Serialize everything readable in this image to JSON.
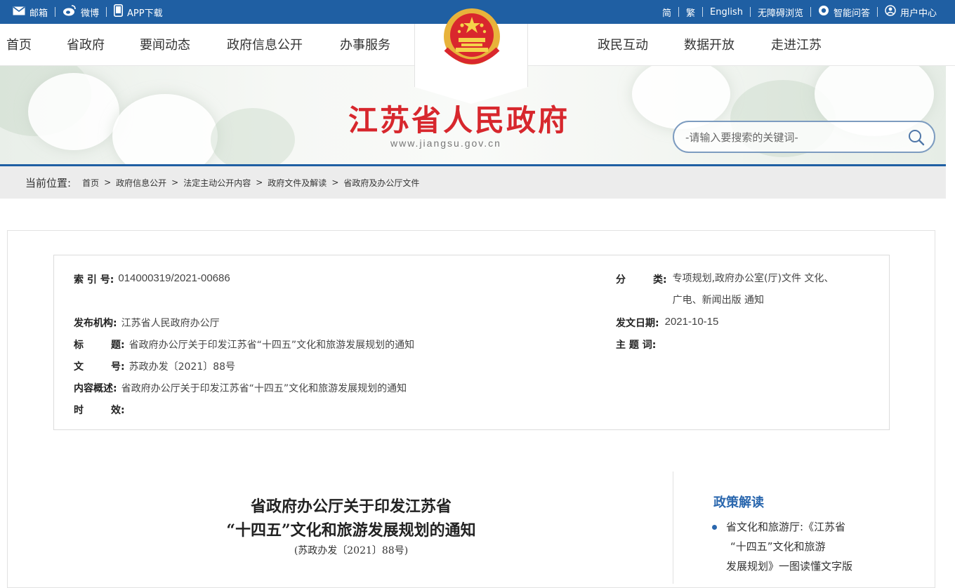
{
  "topbar": {
    "left": [
      {
        "icon": "mail-icon",
        "label": "邮箱"
      },
      {
        "icon": "weibo-icon",
        "label": "微博"
      },
      {
        "icon": "phone-icon",
        "label": "APP下载"
      }
    ],
    "right": [
      {
        "label": "简"
      },
      {
        "label": "繁"
      },
      {
        "label": "English"
      },
      {
        "label": "无障碍浏览"
      },
      {
        "icon": "service-icon",
        "label": "智能问答"
      },
      {
        "icon": "user-icon",
        "label": "用户中心"
      }
    ]
  },
  "nav": {
    "items": [
      "首页",
      "省政府",
      "要闻动态",
      "政府信息公开",
      "办事服务",
      "政民互动",
      "数据开放",
      "走进江苏"
    ]
  },
  "banner": {
    "site_title": "江苏省人民政府",
    "site_url": "www.jiangsu.gov.cn",
    "search_placeholder": "-请输入要搜索的关键词-"
  },
  "breadcrumb": {
    "lead": "当前位置:",
    "items": [
      "首页",
      "政府信息公开",
      "法定主动公开内容",
      "政府文件及解读",
      "省政府及办公厅文件"
    ]
  },
  "meta": {
    "index_label": "索 引 号:",
    "index_value": "014000319/2021-00686",
    "category_label": "分        类:",
    "category_value_line1": "专项规划,政府办公室(厅)文件 文化、",
    "category_value_line2": "广电、新闻出版 通知",
    "publisher_label": "发布机构:",
    "publisher_value": "江苏省人民政府办公厅",
    "date_label": "发文日期:",
    "date_value": "2021-10-15",
    "title_label": "标        题:",
    "title_value": "省政府办公厅关于印发江苏省“十四五”文化和旅游发展规划的通知",
    "subject_label": "主 题 词:",
    "subject_value": "",
    "docno_label": "文        号:",
    "docno_value": "苏政办发〔2021〕88号",
    "summary_label": "内容概述:",
    "summary_value": "省政府办公厅关于印发江苏省“十四五”文化和旅游发展规划的通知",
    "validity_label": "时        效:",
    "validity_value": ""
  },
  "document": {
    "title_line1": "省政府办公厅关于印发江苏省",
    "title_line2": "“十四五”文化和旅游发展规划的通知",
    "doc_number": "(苏政办发〔2021〕88号)"
  },
  "sidebar": {
    "heading": "政策解读",
    "links": [
      {
        "line1": "省文化和旅游厅:《江苏省",
        "line2": "“十四五”文化和旅游",
        "line3": "发展规划》一图读懂文字版"
      }
    ]
  }
}
